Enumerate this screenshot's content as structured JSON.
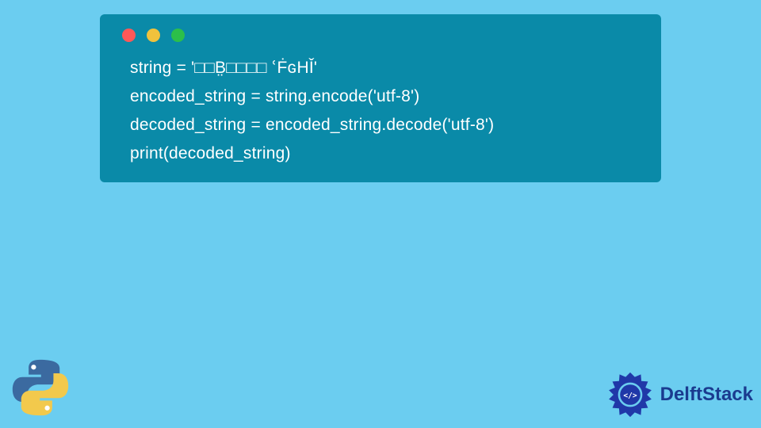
{
  "code": {
    "lines": [
      "string = '□□B̤□□□□ ՙḞɢHǏ'",
      "encoded_string = string.encode('utf-8')",
      "decoded_string = encoded_string.decode('utf-8')",
      "print(decoded_string)"
    ]
  },
  "branding": {
    "site_name": "DelftStack"
  },
  "colors": {
    "page_bg": "#6bcdf0",
    "card_bg": "#0a8aa8",
    "traffic_red": "#ff5858",
    "traffic_yellow": "#f0c23c",
    "traffic_green": "#2cbf4a",
    "brand_blue": "#1a3b8f"
  }
}
